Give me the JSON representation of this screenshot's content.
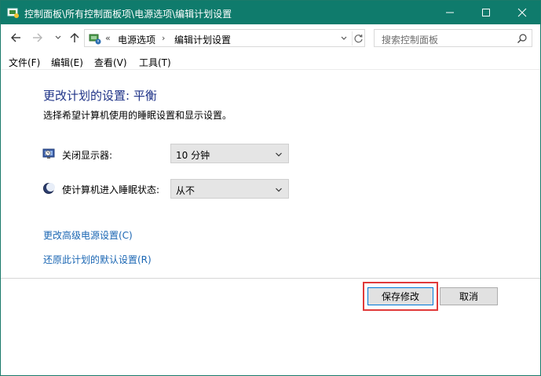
{
  "window": {
    "title": "控制面板\\所有控制面板项\\电源选项\\编辑计划设置",
    "accent_color": "#0f7b6c",
    "controls": [
      "minimize-icon",
      "maximize-icon",
      "close-icon"
    ]
  },
  "nav": {
    "separator": "«",
    "breadcrumb": [
      "电源选项",
      "编辑计划设置"
    ],
    "arrow": "›",
    "search_placeholder": "搜索控制面板"
  },
  "menu": {
    "items": [
      "文件(F)",
      "编辑(E)",
      "查看(V)",
      "工具(T)"
    ]
  },
  "main": {
    "heading": "更改计划的设置: 平衡",
    "subtext": "选择希望计算机使用的睡眠设置和显示设置。",
    "settings": [
      {
        "label": "关闭显示器:",
        "value": "10 分钟",
        "icon": "monitor-clock-icon"
      },
      {
        "label": "使计算机进入睡眠状态:",
        "value": "从不",
        "icon": "moon-sleep-icon"
      }
    ],
    "links": [
      "更改高级电源设置(C)",
      "还原此计划的默认设置(R)"
    ]
  },
  "footer": {
    "save_label": "保存修改",
    "cancel_label": "取消",
    "highlight_color": "#e03a3a"
  }
}
